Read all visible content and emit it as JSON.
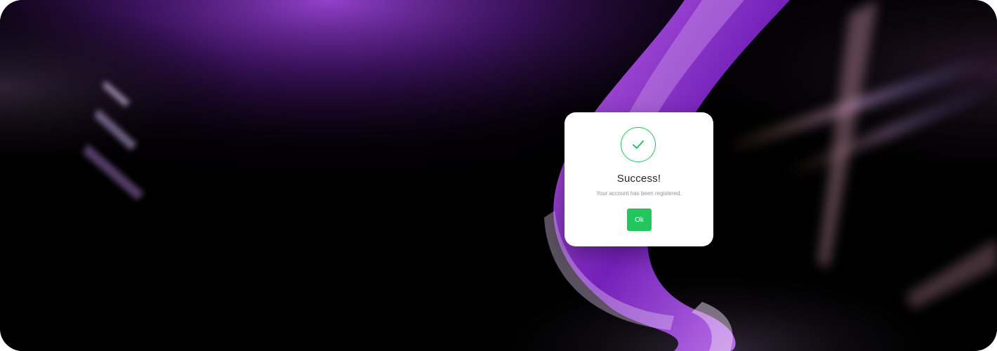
{
  "dialog": {
    "icon": "checkmark-circle-icon",
    "title": "Success!",
    "message": "Your account has been registered.",
    "ok_label": "Ok"
  },
  "colors": {
    "accent": "#22c55e",
    "title": "#1f2430",
    "message": "#8e95a3",
    "background": "#000000",
    "glow_purple": "#8e3fd0"
  },
  "background": {
    "description_icon": "abstract-purple-ribbon-image"
  }
}
